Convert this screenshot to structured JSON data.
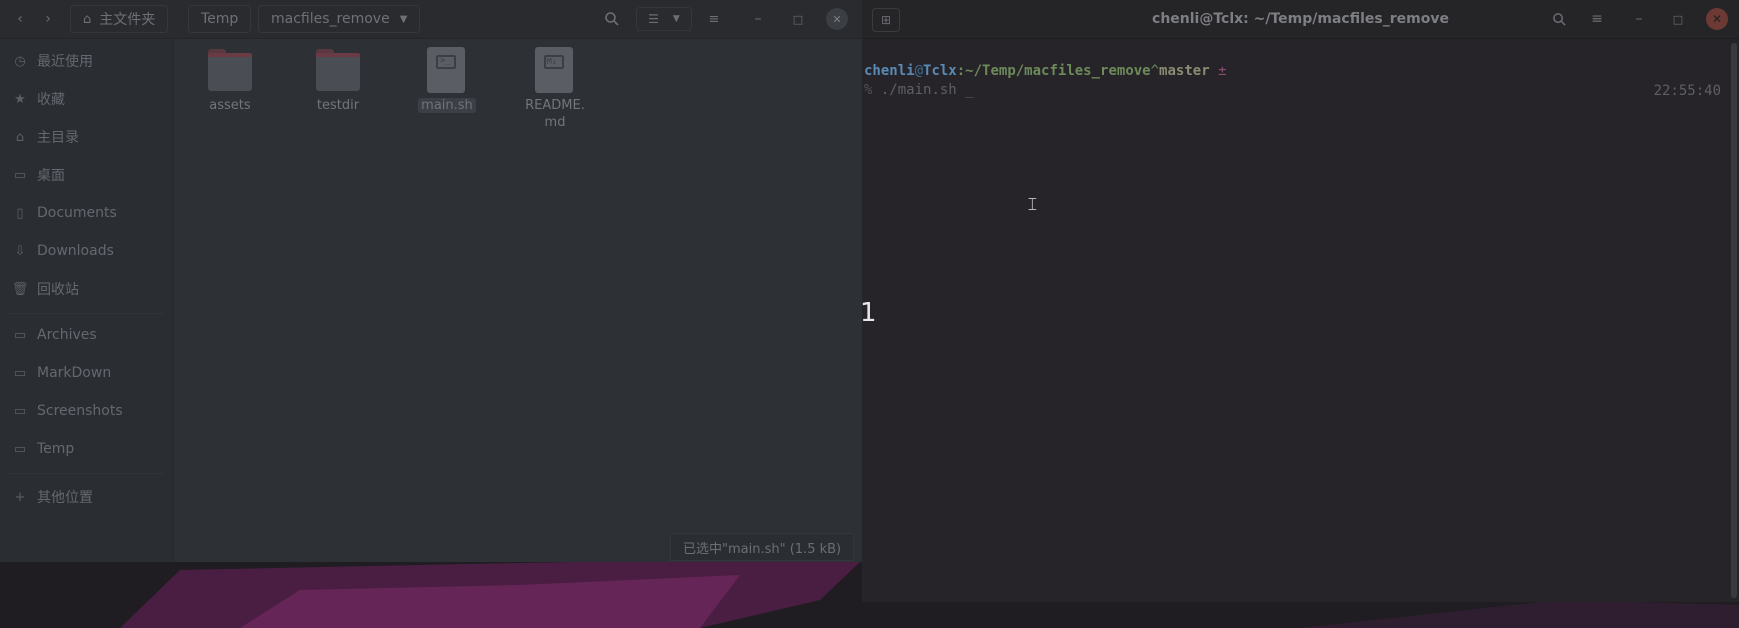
{
  "file_manager": {
    "nav": {
      "back_icon": "chevron-left-icon",
      "forward_icon": "chevron-right-icon"
    },
    "breadcrumbs": [
      {
        "label": "主文件夹",
        "icon": "home-icon"
      },
      {
        "label": "Temp"
      },
      {
        "label": "macfiles_remove",
        "icon": "dropdown-triangle-icon"
      }
    ],
    "toolbar_icons": [
      "search-icon",
      "list-view-icon",
      "view-options-dropdown-icon",
      "menu-icon",
      "minimize-icon",
      "maximize-icon",
      "close-icon"
    ],
    "sidebar": {
      "items": [
        {
          "label": "最近使用",
          "icon": "clock-icon"
        },
        {
          "label": "收藏",
          "icon": "star-icon"
        },
        {
          "label": "主目录",
          "icon": "home-icon"
        },
        {
          "label": "桌面",
          "icon": "desktop-icon"
        },
        {
          "label": "Documents",
          "icon": "document-icon"
        },
        {
          "label": "Downloads",
          "icon": "download-icon"
        },
        {
          "label": "回收站",
          "icon": "trash-icon"
        },
        {
          "label": "Archives",
          "icon": "folder-icon"
        },
        {
          "label": "MarkDown",
          "icon": "folder-icon"
        },
        {
          "label": "Screenshots",
          "icon": "folder-icon"
        },
        {
          "label": "Temp",
          "icon": "folder-icon"
        },
        {
          "label": "其他位置",
          "icon": "plus-icon"
        }
      ]
    },
    "files": [
      {
        "name": "assets",
        "kind": "folder"
      },
      {
        "name": "testdir",
        "kind": "folder"
      },
      {
        "name": "main.sh",
        "kind": "script",
        "glyph": ">_",
        "selected": true
      },
      {
        "name": "README.md",
        "name_line1": "README.",
        "name_line2": "md",
        "kind": "markdown",
        "glyph": "M↓"
      }
    ],
    "status": "已选中\"main.sh\" (1.5 kB)"
  },
  "terminal": {
    "title": "chenli@Tclx: ~/Temp/macfiles_remove",
    "header_icons": [
      "new-tab-icon",
      "search-icon",
      "menu-icon",
      "minimize-icon",
      "maximize-icon",
      "close-icon"
    ],
    "prompt": {
      "user": "chenli",
      "at": "@",
      "host": "Tclx",
      "colon": ":",
      "path": "~/Temp/macfiles_remove",
      "caret": "^",
      "branch": "master",
      "dirty": "±"
    },
    "command_prompt": "%",
    "command": "./main.sh",
    "cursor": "_",
    "time": "22:55:40"
  },
  "overlay": {
    "number": "1"
  },
  "colors": {
    "terminal_bg": "#262329",
    "file_manager_bg": "#2c3035",
    "wallpaper_accent": "#6b2a5e",
    "close_button": "#6d3a33"
  }
}
